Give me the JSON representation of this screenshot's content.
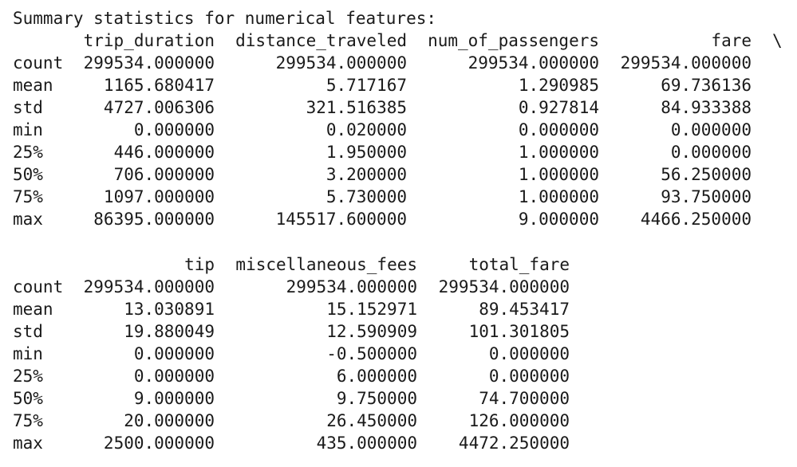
{
  "output": {
    "heading": "Summary statistics for numerical features:",
    "continuation_marker": "\\",
    "block1": {
      "columns": [
        "trip_duration",
        "distance_traveled",
        "num_of_passengers",
        "fare"
      ],
      "rows": [
        {
          "label": "count",
          "values": [
            "299534.000000",
            "299534.000000",
            "299534.000000",
            "299534.000000"
          ]
        },
        {
          "label": "mean",
          "values": [
            "1165.680417",
            "5.717167",
            "1.290985",
            "69.736136"
          ]
        },
        {
          "label": "std",
          "values": [
            "4727.006306",
            "321.516385",
            "0.927814",
            "84.933388"
          ]
        },
        {
          "label": "min",
          "values": [
            "0.000000",
            "0.020000",
            "0.000000",
            "0.000000"
          ]
        },
        {
          "label": "25%",
          "values": [
            "446.000000",
            "1.950000",
            "1.000000",
            "0.000000"
          ]
        },
        {
          "label": "50%",
          "values": [
            "706.000000",
            "3.200000",
            "1.000000",
            "56.250000"
          ]
        },
        {
          "label": "75%",
          "values": [
            "1097.000000",
            "5.730000",
            "1.000000",
            "93.750000"
          ]
        },
        {
          "label": "max",
          "values": [
            "86395.000000",
            "145517.600000",
            "9.000000",
            "4466.250000"
          ]
        }
      ]
    },
    "block2": {
      "columns": [
        "tip",
        "miscellaneous_fees",
        "total_fare"
      ],
      "rows": [
        {
          "label": "count",
          "values": [
            "299534.000000",
            "299534.000000",
            "299534.000000"
          ]
        },
        {
          "label": "mean",
          "values": [
            "13.030891",
            "15.152971",
            "89.453417"
          ]
        },
        {
          "label": "std",
          "values": [
            "19.880049",
            "12.590909",
            "101.301805"
          ]
        },
        {
          "label": "min",
          "values": [
            "0.000000",
            "-0.500000",
            "0.000000"
          ]
        },
        {
          "label": "25%",
          "values": [
            "0.000000",
            "6.000000",
            "0.000000"
          ]
        },
        {
          "label": "50%",
          "values": [
            "9.000000",
            "9.750000",
            "74.700000"
          ]
        },
        {
          "label": "75%",
          "values": [
            "20.000000",
            "26.450000",
            "126.000000"
          ]
        },
        {
          "label": "max",
          "values": [
            "2500.000000",
            "435.000000",
            "4472.250000"
          ]
        }
      ]
    }
  }
}
